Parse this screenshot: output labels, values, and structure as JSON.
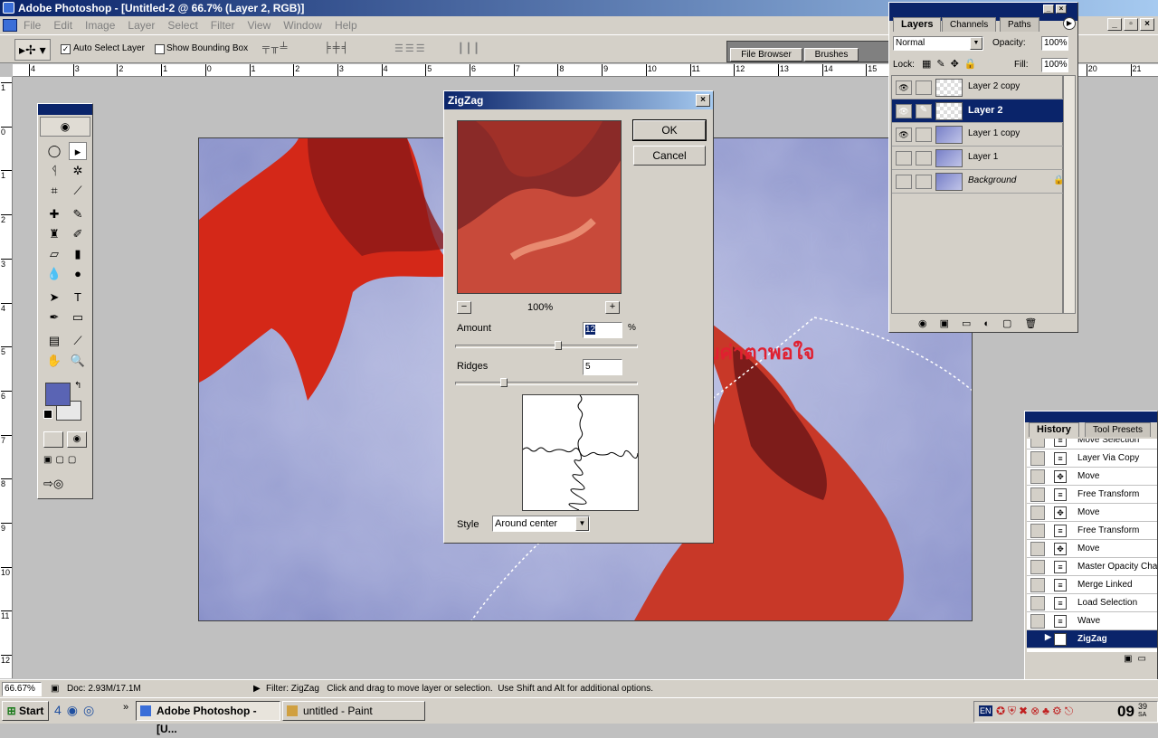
{
  "window": {
    "title": "Adobe Photoshop - [Untitled-2 @ 66.7% (Layer 2, RGB)]"
  },
  "menu": [
    "File",
    "Edit",
    "Image",
    "Layer",
    "Select",
    "Filter",
    "View",
    "Window",
    "Help"
  ],
  "options": {
    "auto_select_layer": "Auto Select Layer",
    "show_bounding_box": "Show Bounding Box",
    "auto_select_checked": true,
    "show_bounding_checked": false
  },
  "palette_well": {
    "file_browser": "File Browser",
    "brushes": "Brushes"
  },
  "ruler_h_ticks": [
    "4",
    "3",
    "2",
    "1",
    "0",
    "1",
    "2",
    "3",
    "4",
    "5",
    "6",
    "7",
    "8",
    "9",
    "10",
    "11",
    "12",
    "13",
    "14",
    "15",
    "16",
    "17",
    "18",
    "19",
    "20",
    "21"
  ],
  "ruler_v_ticks": [
    "1",
    "0",
    "1",
    "2",
    "3",
    "4",
    "5",
    "6",
    "7",
    "8",
    "9",
    "10",
    "11",
    "12",
    "13"
  ],
  "annotation": "13 ปรับค่าตาพอใจ",
  "zigzag": {
    "title": "ZigZag",
    "ok": "OK",
    "cancel": "Cancel",
    "zoom": "100%",
    "zoom_out": "−",
    "zoom_in": "+",
    "amount_label": "Amount",
    "amount_value": "12",
    "amount_unit": "%",
    "amount_fraction": 0.56,
    "ridges_label": "Ridges",
    "ridges_value": "5",
    "ridges_fraction": 0.25,
    "style_label": "Style",
    "style_value": "Around center"
  },
  "layers_panel": {
    "tabs": [
      "Layers",
      "Channels",
      "Paths"
    ],
    "blend_mode": "Normal",
    "opacity_label": "Opacity:",
    "opacity_value": "100%",
    "lock_label": "Lock:",
    "fill_label": "Fill:",
    "fill_value": "100%",
    "layers": [
      {
        "name": "Layer 2 copy",
        "visible": true,
        "selected": false
      },
      {
        "name": "Layer 2",
        "visible": true,
        "selected": true
      },
      {
        "name": "Layer 1  copy",
        "visible": true,
        "selected": false
      },
      {
        "name": "Layer 1",
        "visible": false,
        "selected": false
      },
      {
        "name": "Background",
        "visible": false,
        "selected": false,
        "locked": true
      }
    ]
  },
  "history_panel": {
    "tabs": [
      "History",
      "Tool Presets"
    ],
    "items": [
      {
        "name": "Move Selection",
        "icon": "doc-icon"
      },
      {
        "name": "Layer Via Copy",
        "icon": "doc-icon"
      },
      {
        "name": "Move",
        "icon": "move-icon"
      },
      {
        "name": "Free Transform",
        "icon": "doc-icon"
      },
      {
        "name": "Move",
        "icon": "move-icon"
      },
      {
        "name": "Free Transform",
        "icon": "doc-icon"
      },
      {
        "name": "Move",
        "icon": "move-icon"
      },
      {
        "name": "Master Opacity Cha",
        "icon": "doc-icon"
      },
      {
        "name": "Merge Linked",
        "icon": "doc-icon"
      },
      {
        "name": "Load Selection",
        "icon": "doc-icon"
      },
      {
        "name": "Wave",
        "icon": "doc-icon"
      },
      {
        "name": "ZigZag",
        "icon": "doc-icon",
        "selected": true
      }
    ]
  },
  "status": {
    "zoom": "66.67%",
    "doc": "Doc: 2.93M/17.1M",
    "message": "Filter: ZigZag   Click and drag to move layer or selection.  Use Shift and Alt for additional options."
  },
  "taskbar": {
    "start": "Start",
    "tasks": [
      "Adobe Photoshop - [U...",
      "untitled - Paint"
    ],
    "lang": "EN",
    "clock": "09",
    "clock_sup": "39",
    "clock_sub": "SA"
  },
  "colors": {
    "foreground": "#5a64b4",
    "background": "#e8e8e8",
    "selection": "#0a246a",
    "annotation": "#e02030"
  }
}
